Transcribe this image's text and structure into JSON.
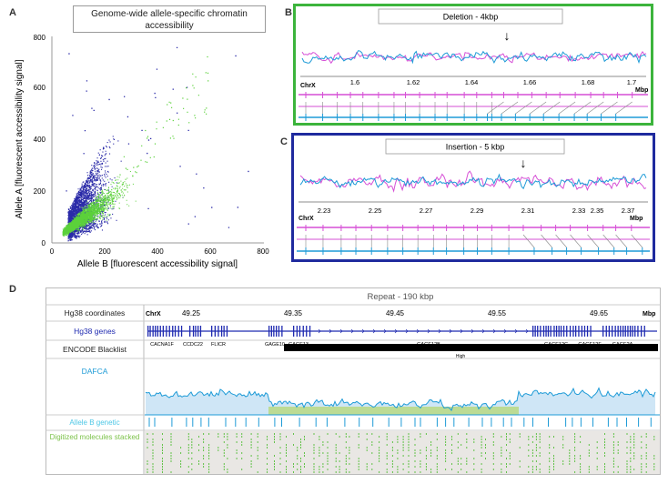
{
  "panels": {
    "a": {
      "letter": "A",
      "title": "Genome-wide allele-specific chromatin accessibility",
      "xlabel": "Allele B [fluorescent accessibility signal]",
      "ylabel": "Allele A [fluorescent accessibility signal]",
      "x_ticks": [
        "0",
        "200",
        "400",
        "600",
        "800"
      ],
      "y_ticks": [
        "0",
        "200",
        "400",
        "600",
        "800"
      ]
    },
    "b": {
      "letter": "B",
      "title": "Deletion - 4kbp",
      "chr": "ChrX",
      "unit": "Mbp",
      "ticks": [
        "1.6",
        "1.62",
        "1.64",
        "1.66",
        "1.68",
        "1.7"
      ],
      "arrow": "↓"
    },
    "c": {
      "letter": "C",
      "title": "Insertion - 5 kbp",
      "chr": "ChrX",
      "unit": "Mbp",
      "ticks": [
        "2.23",
        "2.25",
        "2.27",
        "2.29",
        "2.31",
        "2.33",
        "2.35",
        "2.37"
      ],
      "arrow": "↓"
    },
    "d": {
      "letter": "D",
      "title": "Repeat - 190 kbp",
      "rows": {
        "coords": "Hg38 coordinates",
        "genes": "Hg38 genes",
        "blacklist": "ENCODE Blacklist",
        "dafca": "DAFCA",
        "alleleb": "Allele B genetic",
        "digitized": "Digitized molecules stacked"
      },
      "chr": "ChrX",
      "unit": "Mbp",
      "ticks": [
        "49.25",
        "49.35",
        "49.45",
        "49.55",
        "49.65"
      ],
      "gene_names": [
        "CACNA1F",
        "CCDC22",
        "FLICR",
        "GAGE10",
        "GAGE13",
        "GAGE12B",
        "GAGE12C",
        "GAGE12F",
        "GAGE2A"
      ],
      "blacklist_label": "High"
    }
  },
  "colors": {
    "scatter_blue": "#2a2aa8",
    "scatter_green": "#5bd13a",
    "deletion_border": "#3cb43c",
    "insertion_border": "#1f2a9e",
    "trace_cyan": "#1e9bd7",
    "trace_magenta": "#d64fd6",
    "dafca_fill": "#cfe6f6",
    "green_fill": "#b9d98a",
    "gene_blue": "#1f2ab0"
  }
}
